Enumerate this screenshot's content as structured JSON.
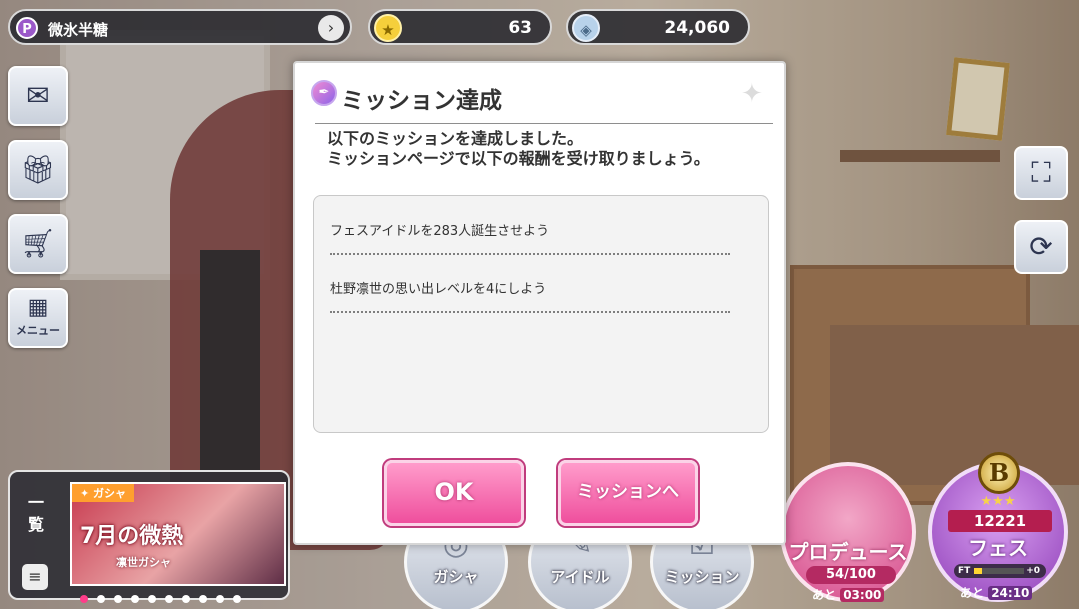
{
  "profile": {
    "badge": "P",
    "name": "微氷半糖"
  },
  "currency": {
    "stars": "63",
    "jewels": "24,060"
  },
  "side_menu": {
    "menu_label": "メニュー"
  },
  "gacha_panel": {
    "side_label_1": "一",
    "side_label_2": "覧",
    "tag": "✦ ガシャ",
    "title": "7月の微熱",
    "subtitle": "凛世ガシャ"
  },
  "bottom_nav": {
    "gacha": "ガシャ",
    "idol": "アイドル",
    "mission": "ミッション"
  },
  "produce": {
    "label": "プロデュース",
    "count": "54/100",
    "timer_prefix": "あと",
    "timer": "03:00"
  },
  "fes": {
    "rank": "B",
    "score": "12221",
    "label": "フェス",
    "ft_label": "FT",
    "ft_plus": "+0",
    "timer_prefix": "あと",
    "timer": "24:10",
    "ft_level": 0.15
  },
  "modal": {
    "title": "ミッション達成",
    "message_line1": "以下のミッションを達成しました。",
    "message_line2": "ミッションページで以下の報酬を受け取りましょう。",
    "missions": [
      "フェスアイドルを283人誕生させよう",
      "杜野凛世の思い出レベルを4にしよう"
    ],
    "ok_label": "OK",
    "mission_button_label": "ミッションへ"
  },
  "colors": {
    "accent_pink": "#ef4f9d",
    "panel_dark": "#28282e",
    "fes_purple": "#8f3fb8"
  }
}
